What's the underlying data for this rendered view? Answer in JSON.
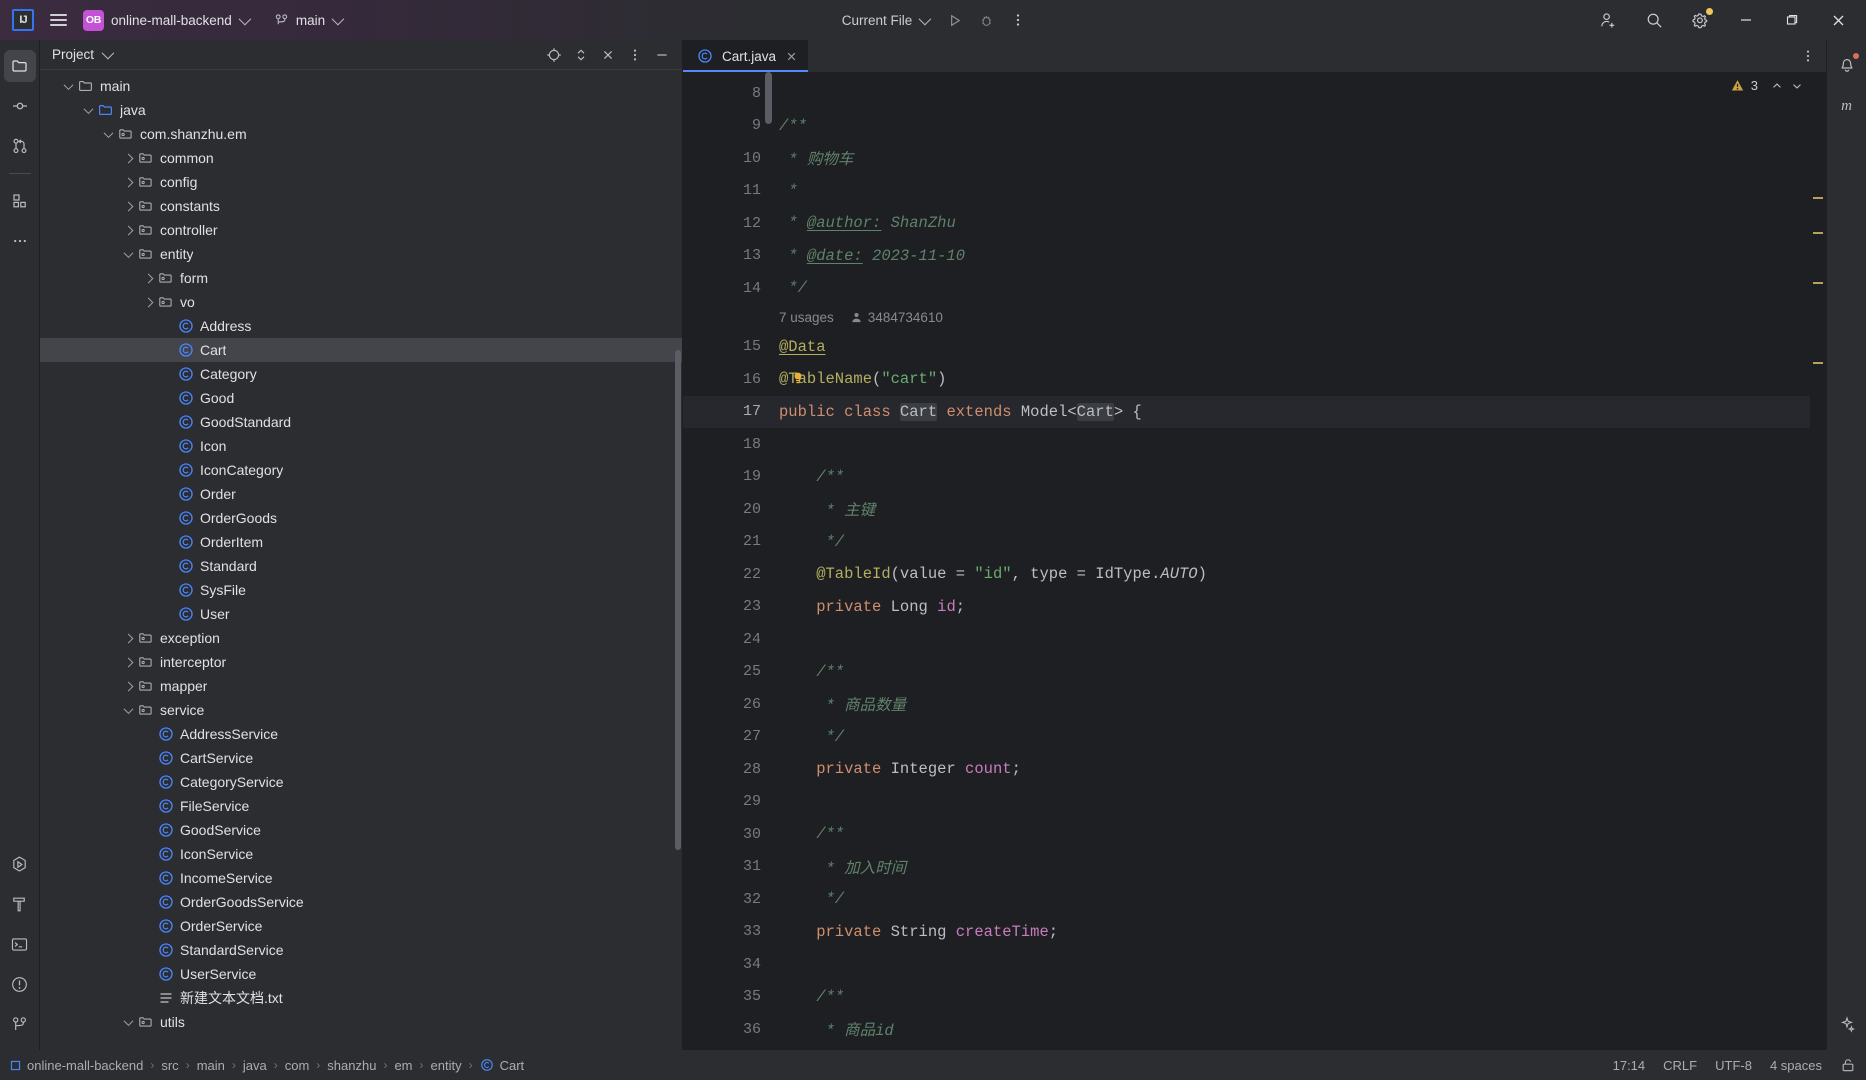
{
  "titlebar": {
    "logo_text": "IJ",
    "menu_icon": "hamburger-icon",
    "project_badge": "OB",
    "project_name": "online-mall-backend",
    "branch_icon": "git-branch-icon",
    "branch_name": "main",
    "run_config": "Current File",
    "run_icon": "run-play-icon",
    "debug_icon": "debug-bug-icon",
    "more_icon": "more-vertical-icon",
    "add_user_icon": "add-user-icon",
    "search_icon": "search-icon",
    "settings_icon": "gear-icon",
    "settings_badge_color": "#f2c55c",
    "minimize_icon": "minimize-icon",
    "maximize_icon": "maximize-icon",
    "close_icon": "close-icon"
  },
  "left_stripe": {
    "items": [
      {
        "name": "project",
        "icon": "folder-icon",
        "active": true
      },
      {
        "name": "commit",
        "icon": "commit-node-icon",
        "active": false
      },
      {
        "name": "pull-requests",
        "icon": "pull-request-icon",
        "active": false
      },
      {
        "name": "structure",
        "icon": "structure-blocks-icon",
        "active": false
      },
      {
        "name": "more-tool-windows",
        "icon": "more-horizontal-icon",
        "active": false
      }
    ],
    "bottom_items": [
      {
        "name": "run",
        "icon": "run-hexagon-icon"
      },
      {
        "name": "build",
        "icon": "hammer-icon"
      },
      {
        "name": "terminal",
        "icon": "terminal-icon"
      },
      {
        "name": "problems",
        "icon": "warning-circle-icon"
      },
      {
        "name": "version-control",
        "icon": "git-branch-icon"
      }
    ]
  },
  "right_stripe": {
    "items": [
      {
        "name": "notifications",
        "icon": "bell-icon",
        "badge": true
      },
      {
        "name": "maven",
        "icon": "maven-m-icon"
      }
    ],
    "bottom_items": [
      {
        "name": "ai-assistant",
        "icon": "sparkle-icon"
      }
    ]
  },
  "project_panel": {
    "title": "Project",
    "title_chevron": "chevron-down-icon",
    "actions": [
      {
        "name": "select-opened-file",
        "icon": "target-icon"
      },
      {
        "name": "expand-collapse",
        "icon": "expand-vertical-icon"
      },
      {
        "name": "collapse-all",
        "icon": "collapse-all-icon"
      },
      {
        "name": "options-menu",
        "icon": "more-vertical-icon"
      },
      {
        "name": "hide-panel",
        "icon": "minimize-panel-icon"
      }
    ],
    "tree": [
      {
        "label": "main",
        "depth": 4,
        "twisty": "open",
        "icon": "folder-plain",
        "selected": false
      },
      {
        "label": "java",
        "depth": 5,
        "twisty": "open",
        "icon": "folder-source",
        "selected": false
      },
      {
        "label": "com.shanzhu.em",
        "depth": 6,
        "twisty": "open",
        "icon": "package",
        "selected": false
      },
      {
        "label": "common",
        "depth": 7,
        "twisty": "closed",
        "icon": "package",
        "selected": false
      },
      {
        "label": "config",
        "depth": 7,
        "twisty": "closed",
        "icon": "package",
        "selected": false
      },
      {
        "label": "constants",
        "depth": 7,
        "twisty": "closed",
        "icon": "package",
        "selected": false
      },
      {
        "label": "controller",
        "depth": 7,
        "twisty": "closed",
        "icon": "package",
        "selected": false
      },
      {
        "label": "entity",
        "depth": 7,
        "twisty": "open",
        "icon": "package",
        "selected": false
      },
      {
        "label": "form",
        "depth": 8,
        "twisty": "closed",
        "icon": "package",
        "selected": false
      },
      {
        "label": "vo",
        "depth": 8,
        "twisty": "closed",
        "icon": "package",
        "selected": false
      },
      {
        "label": "Address",
        "depth": 9,
        "twisty": "none",
        "icon": "class",
        "selected": false
      },
      {
        "label": "Cart",
        "depth": 9,
        "twisty": "none",
        "icon": "class",
        "selected": true
      },
      {
        "label": "Category",
        "depth": 9,
        "twisty": "none",
        "icon": "class",
        "selected": false
      },
      {
        "label": "Good",
        "depth": 9,
        "twisty": "none",
        "icon": "class",
        "selected": false
      },
      {
        "label": "GoodStandard",
        "depth": 9,
        "twisty": "none",
        "icon": "class",
        "selected": false
      },
      {
        "label": "Icon",
        "depth": 9,
        "twisty": "none",
        "icon": "class",
        "selected": false
      },
      {
        "label": "IconCategory",
        "depth": 9,
        "twisty": "none",
        "icon": "class",
        "selected": false
      },
      {
        "label": "Order",
        "depth": 9,
        "twisty": "none",
        "icon": "class",
        "selected": false
      },
      {
        "label": "OrderGoods",
        "depth": 9,
        "twisty": "none",
        "icon": "class",
        "selected": false
      },
      {
        "label": "OrderItem",
        "depth": 9,
        "twisty": "none",
        "icon": "class",
        "selected": false
      },
      {
        "label": "Standard",
        "depth": 9,
        "twisty": "none",
        "icon": "class",
        "selected": false
      },
      {
        "label": "SysFile",
        "depth": 9,
        "twisty": "none",
        "icon": "class",
        "selected": false
      },
      {
        "label": "User",
        "depth": 9,
        "twisty": "none",
        "icon": "class",
        "selected": false
      },
      {
        "label": "exception",
        "depth": 7,
        "twisty": "closed",
        "icon": "package",
        "selected": false
      },
      {
        "label": "interceptor",
        "depth": 7,
        "twisty": "closed",
        "icon": "package",
        "selected": false
      },
      {
        "label": "mapper",
        "depth": 7,
        "twisty": "closed",
        "icon": "package",
        "selected": false
      },
      {
        "label": "service",
        "depth": 7,
        "twisty": "open",
        "icon": "package",
        "selected": false
      },
      {
        "label": "AddressService",
        "depth": 8,
        "twisty": "none",
        "icon": "class",
        "selected": false
      },
      {
        "label": "CartService",
        "depth": 8,
        "twisty": "none",
        "icon": "class",
        "selected": false
      },
      {
        "label": "CategoryService",
        "depth": 8,
        "twisty": "none",
        "icon": "class",
        "selected": false
      },
      {
        "label": "FileService",
        "depth": 8,
        "twisty": "none",
        "icon": "class",
        "selected": false
      },
      {
        "label": "GoodService",
        "depth": 8,
        "twisty": "none",
        "icon": "class",
        "selected": false
      },
      {
        "label": "IconService",
        "depth": 8,
        "twisty": "none",
        "icon": "class",
        "selected": false
      },
      {
        "label": "IncomeService",
        "depth": 8,
        "twisty": "none",
        "icon": "class",
        "selected": false
      },
      {
        "label": "OrderGoodsService",
        "depth": 8,
        "twisty": "none",
        "icon": "class",
        "selected": false
      },
      {
        "label": "OrderService",
        "depth": 8,
        "twisty": "none",
        "icon": "class",
        "selected": false
      },
      {
        "label": "StandardService",
        "depth": 8,
        "twisty": "none",
        "icon": "class",
        "selected": false
      },
      {
        "label": "UserService",
        "depth": 8,
        "twisty": "none",
        "icon": "class",
        "selected": false
      },
      {
        "label": "新建文本文档.txt",
        "depth": 8,
        "twisty": "none",
        "icon": "text-file",
        "selected": false
      },
      {
        "label": "utils",
        "depth": 7,
        "twisty": "open",
        "icon": "package",
        "selected": false
      }
    ]
  },
  "editor": {
    "tabs": [
      {
        "label": "Cart.java",
        "icon": "java-class-icon",
        "active": true,
        "close_icon": "close-icon"
      }
    ],
    "tab_options_icon": "more-vertical-icon",
    "inspection": {
      "count": "3",
      "icon": "warning-triangle-icon",
      "prev_icon": "chevron-up-icon",
      "next_icon": "chevron-down-icon"
    },
    "inlay_hint": {
      "usages": "7 usages",
      "author_icon": "person-icon",
      "author": "3484734610"
    },
    "current_line": 17,
    "lines": [
      {
        "n": 8,
        "segments": []
      },
      {
        "n": 9,
        "segments": [
          {
            "t": "/**",
            "c": "cmt"
          }
        ]
      },
      {
        "n": 10,
        "segments": [
          {
            "t": " * 购物车",
            "c": "cmt"
          }
        ]
      },
      {
        "n": 11,
        "segments": [
          {
            "t": " *",
            "c": "cmt"
          }
        ]
      },
      {
        "n": 12,
        "segments": [
          {
            "t": " * ",
            "c": "cmt"
          },
          {
            "t": "@author:",
            "c": "cmt squig uline"
          },
          {
            "t": " ShanZhu",
            "c": "cmt"
          }
        ]
      },
      {
        "n": 13,
        "segments": [
          {
            "t": " * ",
            "c": "cmt"
          },
          {
            "t": "@date:",
            "c": "cmt squig uline"
          },
          {
            "t": " 2023-11-10",
            "c": "cmt"
          }
        ]
      },
      {
        "n": 14,
        "segments": [
          {
            "t": " */",
            "c": "cmt"
          }
        ]
      },
      {
        "n": 15,
        "segments": [
          {
            "t": "@Data",
            "c": "ann squig uline"
          }
        ]
      },
      {
        "n": 16,
        "segments": [
          {
            "t": "@TableName",
            "c": "ann"
          },
          {
            "t": "(",
            "c": "ident"
          },
          {
            "t": "\"cart\"",
            "c": "str"
          },
          {
            "t": ")",
            "c": "ident"
          }
        ],
        "bulb": true
      },
      {
        "n": 17,
        "segments": [
          {
            "t": "public class ",
            "c": "kw"
          },
          {
            "t": "Cart",
            "c": "typ hl"
          },
          {
            "t": " extends ",
            "c": "kw"
          },
          {
            "t": "Model<",
            "c": "typ"
          },
          {
            "t": "Cart",
            "c": "typ hl"
          },
          {
            "t": "> {",
            "c": "typ"
          }
        ]
      },
      {
        "n": 18,
        "segments": []
      },
      {
        "n": 19,
        "segments": [
          {
            "t": "    /**",
            "c": "cmt"
          }
        ]
      },
      {
        "n": 20,
        "segments": [
          {
            "t": "     * 主键",
            "c": "cmt"
          }
        ]
      },
      {
        "n": 21,
        "segments": [
          {
            "t": "     */",
            "c": "cmt"
          }
        ]
      },
      {
        "n": 22,
        "segments": [
          {
            "t": "    @TableId",
            "c": "ann"
          },
          {
            "t": "(value = ",
            "c": "ident"
          },
          {
            "t": "\"id\"",
            "c": "str"
          },
          {
            "t": ", type = IdType.",
            "c": "ident"
          },
          {
            "t": "AUTO",
            "c": "stat"
          },
          {
            "t": ")",
            "c": "ident"
          }
        ]
      },
      {
        "n": 23,
        "segments": [
          {
            "t": "    private ",
            "c": "kw"
          },
          {
            "t": "Long ",
            "c": "typ"
          },
          {
            "t": "id",
            "c": "fld"
          },
          {
            "t": ";",
            "c": "ident"
          }
        ]
      },
      {
        "n": 24,
        "segments": []
      },
      {
        "n": 25,
        "segments": [
          {
            "t": "    /**",
            "c": "cmt"
          }
        ]
      },
      {
        "n": 26,
        "segments": [
          {
            "t": "     * 商品数量",
            "c": "cmt"
          }
        ]
      },
      {
        "n": 27,
        "segments": [
          {
            "t": "     */",
            "c": "cmt"
          }
        ]
      },
      {
        "n": 28,
        "segments": [
          {
            "t": "    private ",
            "c": "kw"
          },
          {
            "t": "Integer ",
            "c": "typ"
          },
          {
            "t": "count",
            "c": "fld"
          },
          {
            "t": ";",
            "c": "ident"
          }
        ]
      },
      {
        "n": 29,
        "segments": []
      },
      {
        "n": 30,
        "segments": [
          {
            "t": "    /**",
            "c": "cmt"
          }
        ]
      },
      {
        "n": 31,
        "segments": [
          {
            "t": "     * 加入时间",
            "c": "cmt"
          }
        ]
      },
      {
        "n": 32,
        "segments": [
          {
            "t": "     */",
            "c": "cmt"
          }
        ]
      },
      {
        "n": 33,
        "segments": [
          {
            "t": "    private ",
            "c": "kw"
          },
          {
            "t": "String ",
            "c": "typ"
          },
          {
            "t": "createTime",
            "c": "fld"
          },
          {
            "t": ";",
            "c": "ident"
          }
        ]
      },
      {
        "n": 34,
        "segments": []
      },
      {
        "n": 35,
        "segments": [
          {
            "t": "    /**",
            "c": "cmt"
          }
        ]
      },
      {
        "n": 36,
        "segments": [
          {
            "t": "     * 商品id",
            "c": "cmt"
          }
        ]
      }
    ]
  },
  "statusbar": {
    "breadcrumbs": [
      {
        "label": "online-mall-backend",
        "icon": "module-icon"
      },
      {
        "label": "src",
        "icon": ""
      },
      {
        "label": "main",
        "icon": ""
      },
      {
        "label": "java",
        "icon": ""
      },
      {
        "label": "com",
        "icon": ""
      },
      {
        "label": "shanzhu",
        "icon": ""
      },
      {
        "label": "em",
        "icon": ""
      },
      {
        "label": "entity",
        "icon": ""
      },
      {
        "label": "Cart",
        "icon": "class-icon"
      }
    ],
    "caret_position": "17:14",
    "line_separator": "CRLF",
    "encoding": "UTF-8",
    "indent": "4 spaces",
    "readonly_icon": "unlock-icon"
  }
}
